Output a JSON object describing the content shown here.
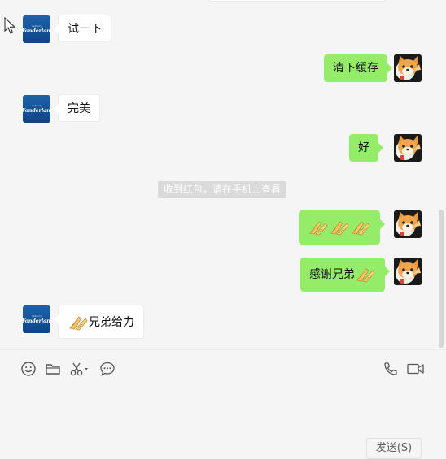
{
  "messages": [
    {
      "side": "left",
      "text": "试一下"
    },
    {
      "side": "right",
      "text": "清下缓存"
    },
    {
      "side": "left",
      "text": "完美"
    },
    {
      "side": "right",
      "text": "好"
    },
    {
      "side": "right",
      "emoji_count": 3,
      "emoji": "wheat-cup-emoji"
    },
    {
      "side": "right",
      "text": "感谢兄弟",
      "emoji": "wheat-cup-emoji"
    },
    {
      "side": "left",
      "text": "兄弟给力",
      "emoji": "wheat-cup-emoji"
    }
  ],
  "system_notice": "收到红包，请在手机上查看",
  "avatars": {
    "brand": {
      "top_text": "cadbury",
      "main_text": "Wonderland",
      "color": "#1a5aa0"
    },
    "self": {
      "icon": "corgi-avatar"
    }
  },
  "toolbar": {
    "left": [
      "smiley-icon",
      "folder-icon",
      "scissors-icon",
      "chat-bubble-icon"
    ],
    "right": [
      "phone-icon",
      "video-icon"
    ]
  },
  "input": {
    "value": ""
  },
  "send_button": {
    "label": "发送(S)"
  },
  "colors": {
    "outgoing_bubble": "#95ec69",
    "incoming_bubble": "#ffffff",
    "background": "#f5f5f5"
  }
}
